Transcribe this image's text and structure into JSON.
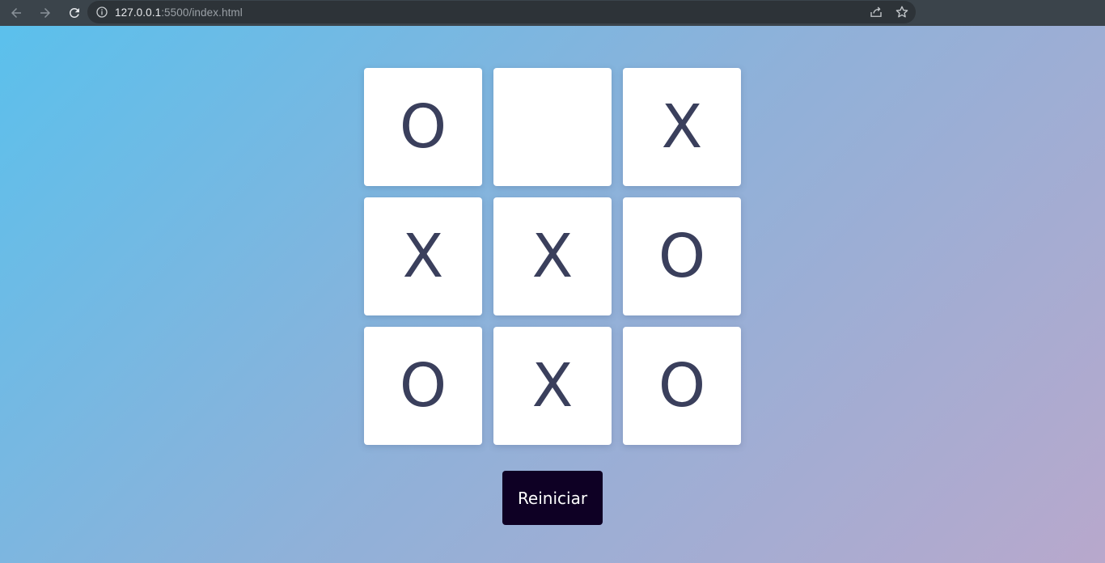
{
  "browser": {
    "url_host": "127.0.0.1",
    "url_rest": ":5500/index.html",
    "icons": [
      "back-arrow-icon",
      "forward-arrow-icon",
      "reload-icon",
      "info-icon",
      "share-icon",
      "star-icon"
    ]
  },
  "game": {
    "cells": [
      "O",
      "",
      "X",
      "X",
      "X",
      "O",
      "O",
      "X",
      "O"
    ],
    "restart_label": "Reiniciar"
  },
  "colors": {
    "mark": "#3a3f5c",
    "button": "#0e0024",
    "gradient_start": "#5bc0ec",
    "gradient_end": "#b8a8cc"
  }
}
